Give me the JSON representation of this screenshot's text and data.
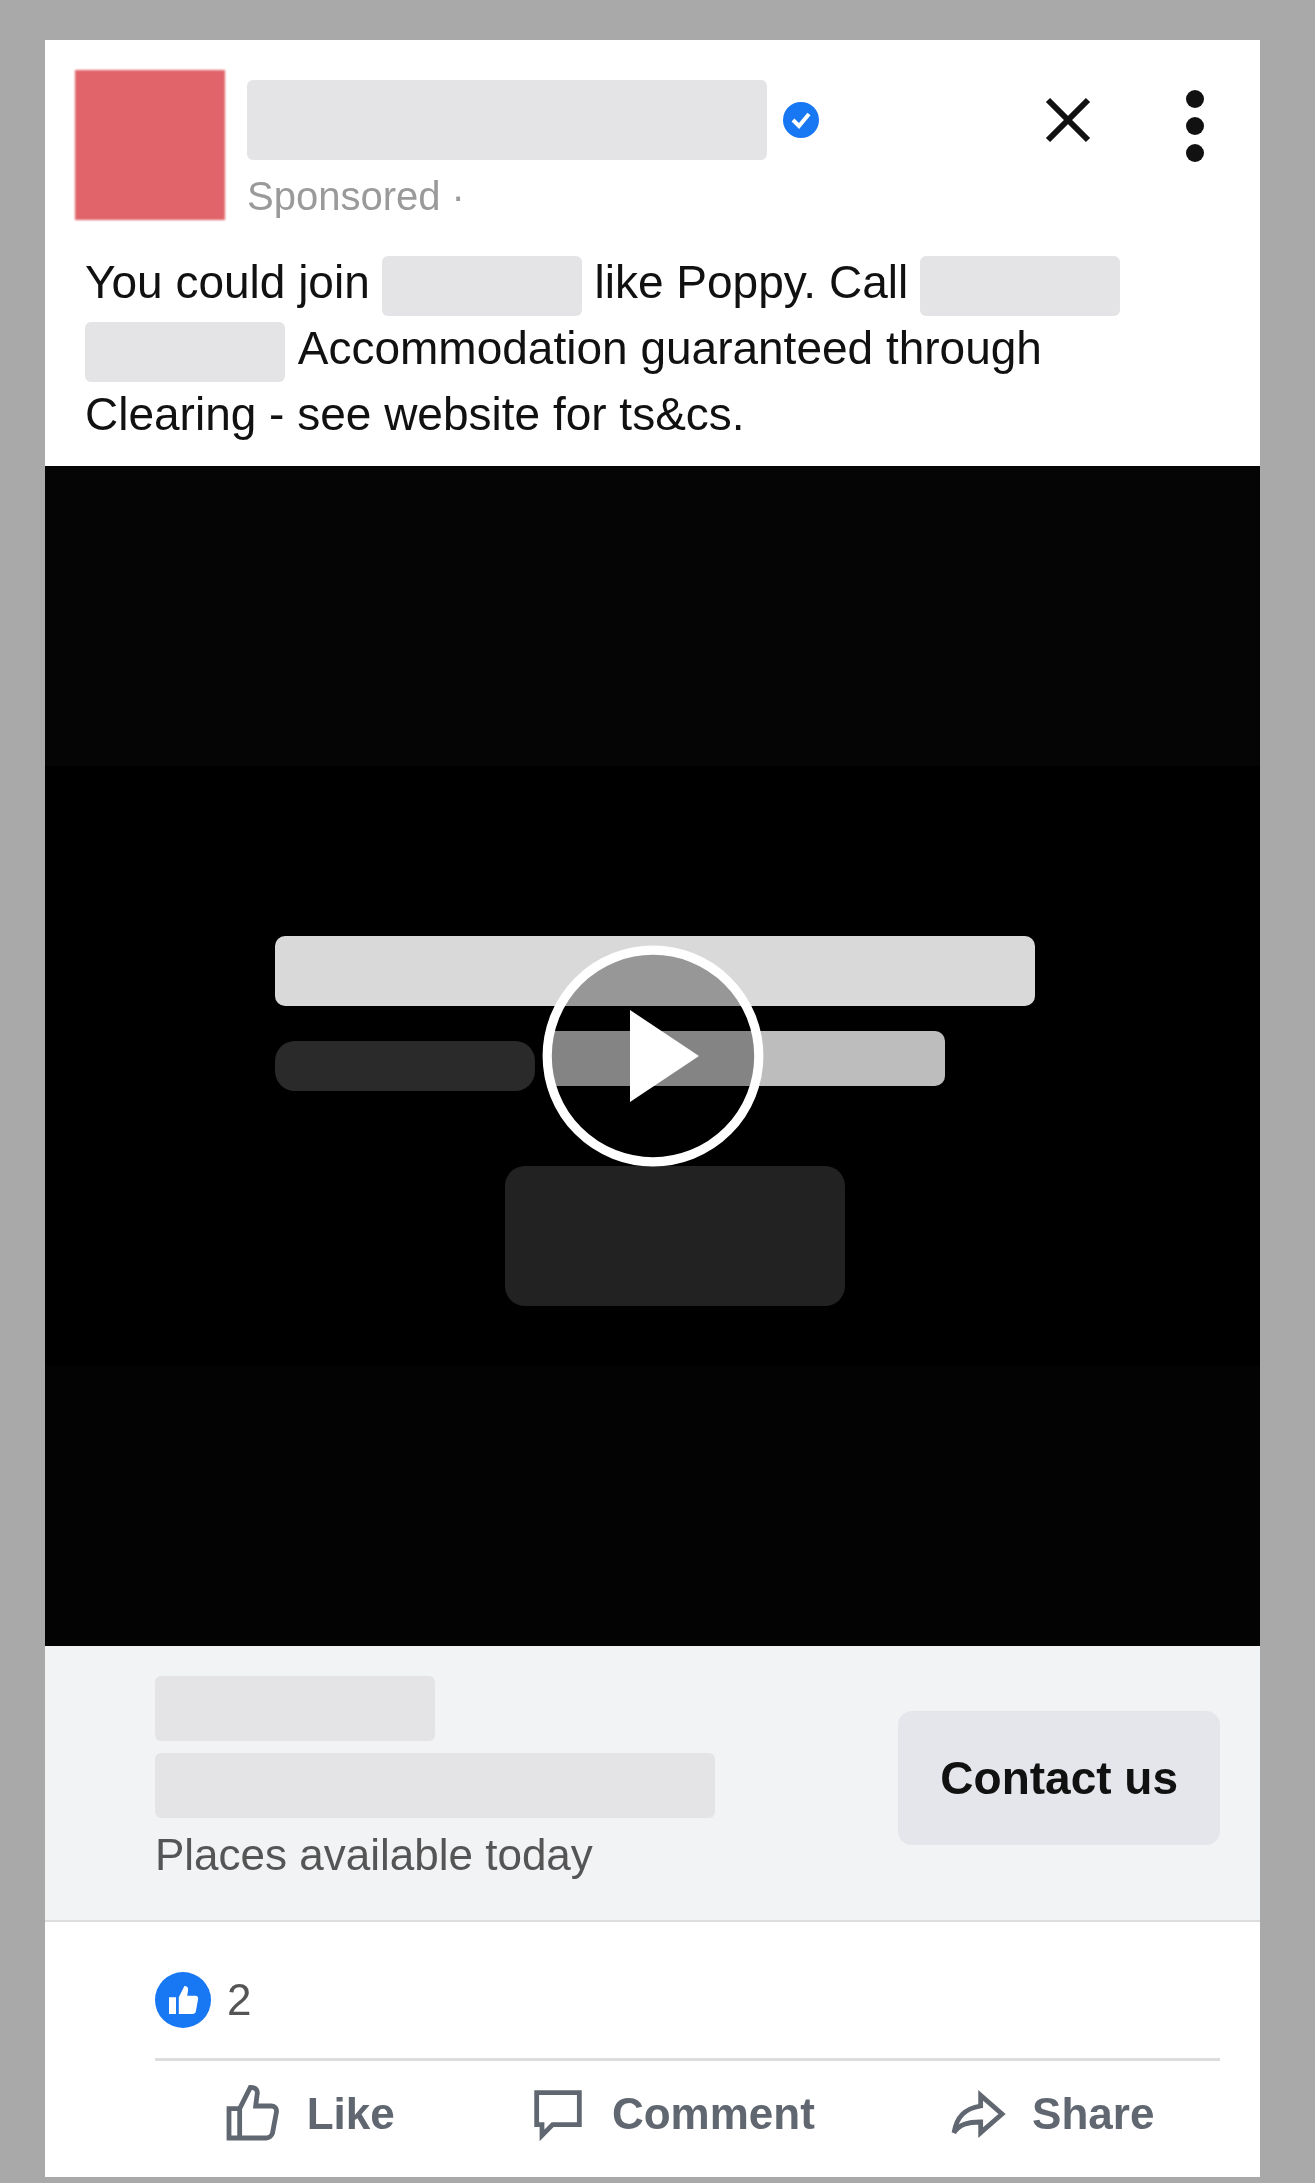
{
  "post": {
    "avatar": {
      "kind": "redacted"
    },
    "page_name": {
      "kind": "redacted"
    },
    "verified": true,
    "subtitle": "Sponsored ·",
    "caption": [
      {
        "kind": "text",
        "text": "You could join"
      },
      {
        "kind": "redacted"
      },
      {
        "kind": "text",
        "text": "like Poppy. Call"
      },
      {
        "kind": "redacted"
      },
      {
        "kind": "redacted"
      },
      {
        "kind": "text",
        "text": "Accommodation guaranteed through"
      },
      {
        "kind": "text",
        "text": "Clearing - see website for ts&cs."
      }
    ],
    "media": {
      "kind": "picture",
      "playable": true
    },
    "link": {
      "lines": [
        {
          "kind": "redacted"
        },
        {
          "kind": "redacted"
        }
      ],
      "description": "Places available today",
      "button": "Contact us"
    },
    "reactions": {
      "count": "2"
    },
    "actions": [
      {
        "kind": "like",
        "label": "Like"
      },
      {
        "kind": "comment",
        "label": "Comment"
      },
      {
        "kind": "share",
        "label": "Share"
      }
    ]
  }
}
